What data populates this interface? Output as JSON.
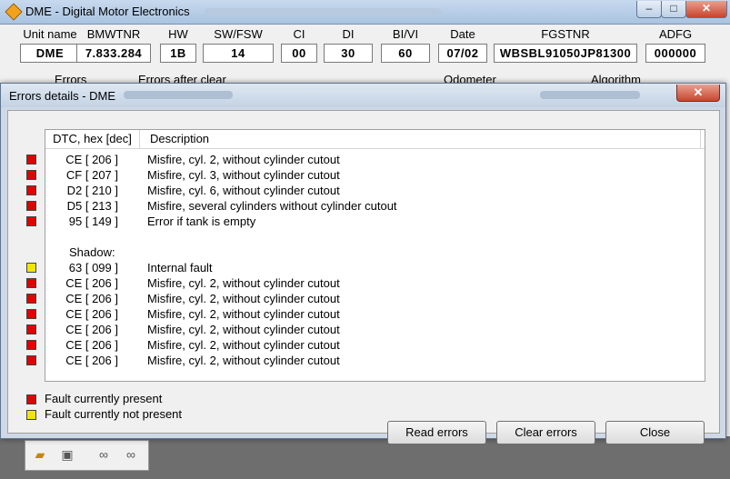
{
  "window": {
    "title": "DME - Digital Motor Electronics"
  },
  "info": {
    "columns": [
      {
        "label": "Unit name",
        "value": "DME"
      },
      {
        "label": "BMWTNR",
        "value": "7.833.284"
      },
      {
        "label": "HW",
        "value": "1B"
      },
      {
        "label": "SW/FSW",
        "value": "14"
      },
      {
        "label": "CI",
        "value": "00"
      },
      {
        "label": "DI",
        "value": "30"
      },
      {
        "label": "BI/VI",
        "value": "60"
      },
      {
        "label": "Date",
        "value": "07/02"
      },
      {
        "label": "FGSTNR",
        "value": "WBSBL91050JP81300"
      },
      {
        "label": "ADFG",
        "value": "000000"
      }
    ],
    "row2_labels": {
      "errors": "Errors",
      "errors_after_clear": "Errors after clear",
      "odometer": "Odometer",
      "algorithm": "Algorithm"
    }
  },
  "dialog": {
    "title": "Errors details - DME",
    "close_label": "✕",
    "list": {
      "headers": {
        "code": "DTC, hex [dec]",
        "description": "Description"
      },
      "rows": [
        {
          "color": "red",
          "code": "CE [ 206 ]",
          "desc": "Misfire, cyl. 2, without cylinder cutout"
        },
        {
          "color": "red",
          "code": "CF [ 207 ]",
          "desc": "Misfire, cyl. 3, without cylinder cutout"
        },
        {
          "color": "red",
          "code": "D2 [ 210 ]",
          "desc": "Misfire, cyl. 6, without cylinder cutout"
        },
        {
          "color": "red",
          "code": "D5 [ 213 ]",
          "desc": "Misfire, several cylinders without cylinder cutout"
        },
        {
          "color": "red",
          "code": "95 [ 149 ]",
          "desc": "Error if tank is empty"
        }
      ],
      "shadow_label": "Shadow:",
      "shadow_rows": [
        {
          "color": "yellow",
          "code": "63 [ 099 ]",
          "desc": "Internal fault"
        },
        {
          "color": "red",
          "code": "CE [ 206 ]",
          "desc": "Misfire, cyl. 2, without cylinder cutout"
        },
        {
          "color": "red",
          "code": "CE [ 206 ]",
          "desc": "Misfire, cyl. 2, without cylinder cutout"
        },
        {
          "color": "red",
          "code": "CE [ 206 ]",
          "desc": "Misfire, cyl. 2, without cylinder cutout"
        },
        {
          "color": "red",
          "code": "CE [ 206 ]",
          "desc": "Misfire, cyl. 2, without cylinder cutout"
        },
        {
          "color": "red",
          "code": "CE [ 206 ]",
          "desc": "Misfire, cyl. 2, without cylinder cutout"
        },
        {
          "color": "red",
          "code": "CE [ 206 ]",
          "desc": "Misfire, cyl. 2, without cylinder cutout"
        }
      ]
    },
    "legend": {
      "present": "Fault currently present",
      "not_present": "Fault currently not present"
    },
    "buttons": {
      "read": "Read errors",
      "clear": "Clear errors",
      "close": "Close"
    }
  },
  "colors": {
    "red": "#e00000",
    "yellow": "#f2e600"
  },
  "toolbar": {
    "icons": [
      "open-folder-icon",
      "save-icon",
      "binoculars-icon",
      "binoculars-icon"
    ]
  }
}
